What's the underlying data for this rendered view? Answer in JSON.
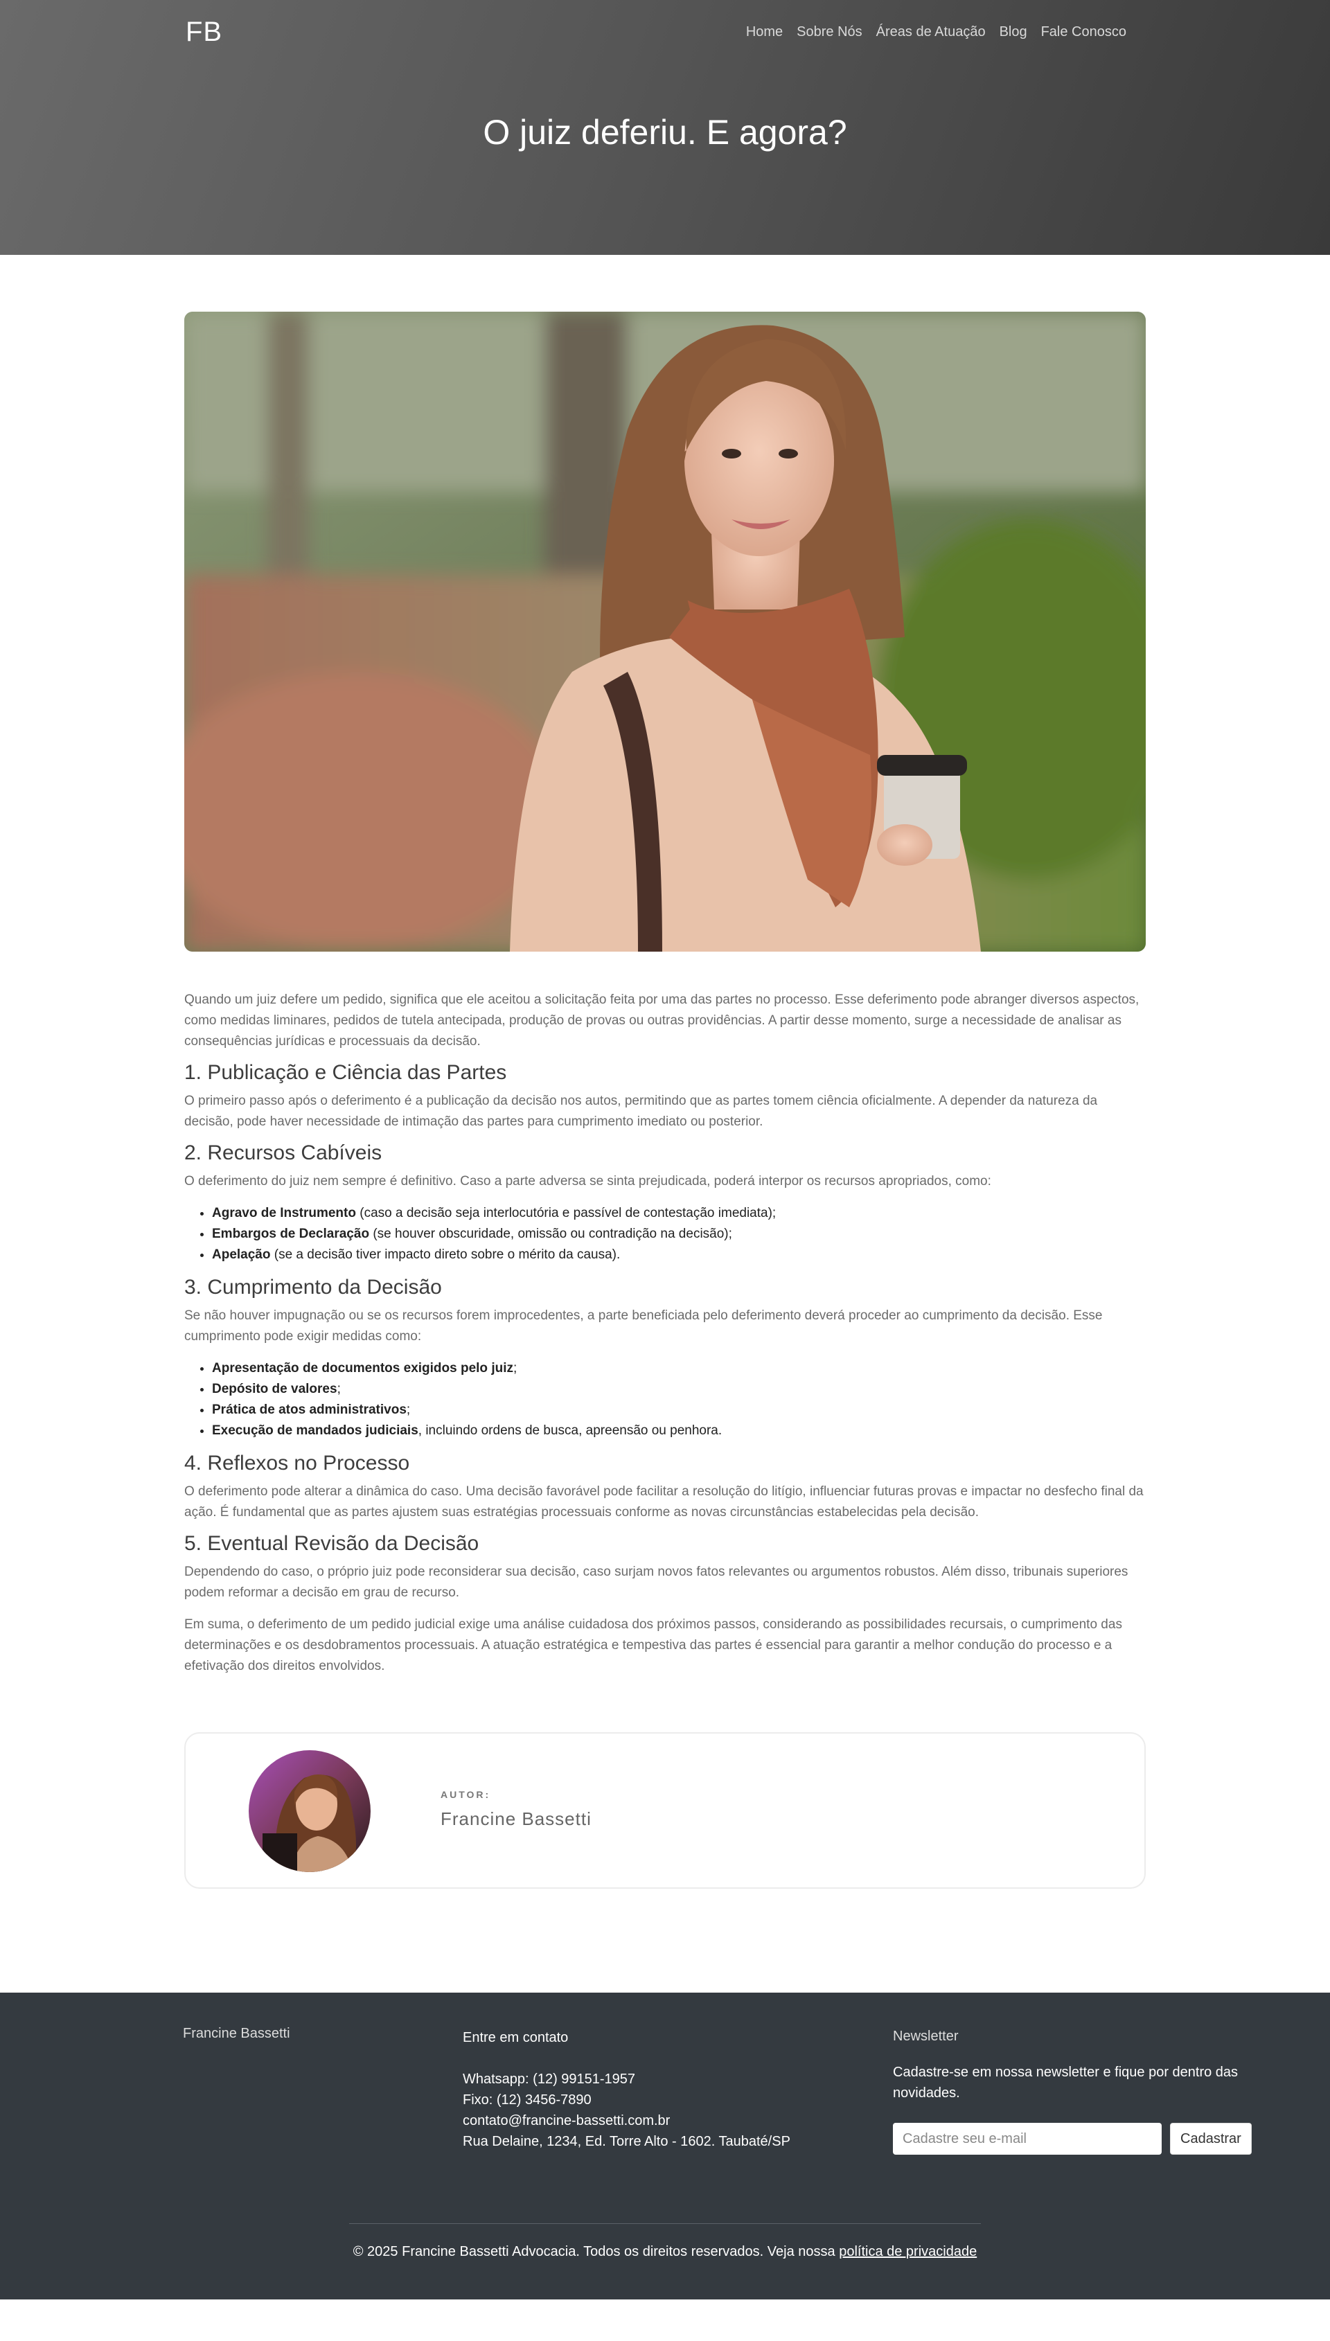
{
  "header": {
    "logo": "FB",
    "nav": [
      "Home",
      "Sobre Nós",
      "Áreas de Atuação",
      "Blog",
      "Fale Conosco"
    ],
    "title": "O juiz deferiu. E agora?"
  },
  "article": {
    "intro": "Quando um juiz defere um pedido, significa que ele aceitou a solicitação feita por uma das partes no processo. Esse deferimento pode abranger diversos aspectos, como medidas liminares, pedidos de tutela antecipada, produção de provas ou outras providências. A partir desse momento, surge a necessidade de analisar as consequências jurídicas e processuais da decisão.",
    "s1": {
      "title": "1. Publicação e Ciência das Partes",
      "text": "O primeiro passo após o deferimento é a publicação da decisão nos autos, permitindo que as partes tomem ciência oficialmente. A depender da natureza da decisão, pode haver necessidade de intimação das partes para cumprimento imediato ou posterior."
    },
    "s2": {
      "title": "2. Recursos Cabíveis",
      "text": "O deferimento do juiz nem sempre é definitivo. Caso a parte adversa se sinta prejudicada, poderá interpor os recursos apropriados, como:",
      "items": [
        {
          "bold": "Agravo de Instrumento",
          "rest": " (caso a decisão seja interlocutória e passível de contestação imediata);"
        },
        {
          "bold": "Embargos de Declaração",
          "rest": " (se houver obscuridade, omissão ou contradição na decisão);"
        },
        {
          "bold": "Apelação",
          "rest": " (se a decisão tiver impacto direto sobre o mérito da causa)."
        }
      ]
    },
    "s3": {
      "title": "3. Cumprimento da Decisão",
      "text": "Se não houver impugnação ou se os recursos forem improcedentes, a parte beneficiada pelo deferimento deverá proceder ao cumprimento da decisão. Esse cumprimento pode exigir medidas como:",
      "items": [
        {
          "bold": "Apresentação de documentos exigidos pelo juiz",
          "rest": ";"
        },
        {
          "bold": "Depósito de valores",
          "rest": ";"
        },
        {
          "bold": "Prática de atos administrativos",
          "rest": ";"
        },
        {
          "bold": "Execução de mandados judiciais",
          "rest": ", incluindo ordens de busca, apreensão ou penhora."
        }
      ]
    },
    "s4": {
      "title": "4. Reflexos no Processo",
      "text": "O deferimento pode alterar a dinâmica do caso. Uma decisão favorável pode facilitar a resolução do litígio, influenciar futuras provas e impactar no desfecho final da ação. É fundamental que as partes ajustem suas estratégias processuais conforme as novas circunstâncias estabelecidas pela decisão."
    },
    "s5": {
      "title": "5. Eventual Revisão da Decisão",
      "text": "Dependendo do caso, o próprio juiz pode reconsiderar sua decisão, caso surjam novos fatos relevantes ou argumentos robustos. Além disso, tribunais superiores podem reformar a decisão em grau de recurso."
    },
    "conclusion": "Em suma, o deferimento de um pedido judicial exige uma análise cuidadosa dos próximos passos, considerando as possibilidades recursais, o cumprimento das determinações e os desdobramentos processuais. A atuação estratégica e tempestiva das partes é essencial para garantir a melhor condução do processo e a efetivação dos direitos envolvidos."
  },
  "author": {
    "label": "AUTOR:",
    "name": "Francine Bassetti"
  },
  "footer": {
    "brand": "Francine Bassetti",
    "contact_title": "Entre em contato",
    "whatsapp": "Whatsapp: (12) 99151-1957",
    "phone": "Fixo: (12) 3456-7890",
    "email": "contato@francine-bassetti.com.br",
    "address": "Rua Delaine, 1234, Ed. Torre Alto - 1602. Taubaté/SP",
    "newsletter_title": "Newsletter",
    "newsletter_text": "Cadastre-se em nossa newsletter e fique por dentro das novidades.",
    "newsletter_placeholder": "Cadastre seu e-mail",
    "newsletter_button": "Cadastrar",
    "copyright": "© 2025 Francine Bassetti Advocacia. Todos os direitos reservados. Veja nossa ",
    "privacy_link": "política de privacidade"
  }
}
